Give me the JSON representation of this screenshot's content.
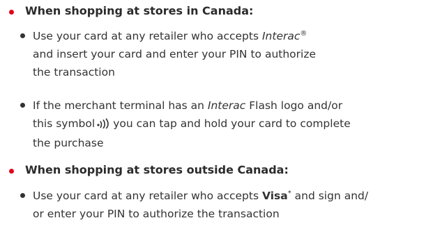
{
  "sections": [
    {
      "heading": "When shopping at stores in Canada:",
      "items": [
        {
          "line1_prefix": "Use your card at any retailer who accepts ",
          "line1_italic": "Interac",
          "line1_mark": "®",
          "line2": "and insert your card and enter your PIN to authorize",
          "line3": "the transaction"
        },
        {
          "line1_prefix": "If the merchant terminal has an ",
          "line1_italic": "Interac",
          "line1_suffix": " Flash logo and/or",
          "line2_prefix": "this symbol",
          "line2_icon": "contactless-icon",
          "line2_suffix": "you can tap and hold your card to complete",
          "line3": "the purchase"
        }
      ]
    },
    {
      "heading": "When shopping at stores outside Canada:",
      "items": [
        {
          "line1_prefix": "Use your card at any retailer who accepts ",
          "line1_bold": "Visa",
          "line1_mark": "*",
          "line1_suffix": " and sign and/",
          "line2": "or enter your PIN to authorize the transaction"
        }
      ]
    }
  ],
  "colors": {
    "accent_red": "#e3001b",
    "text": "#333333"
  }
}
